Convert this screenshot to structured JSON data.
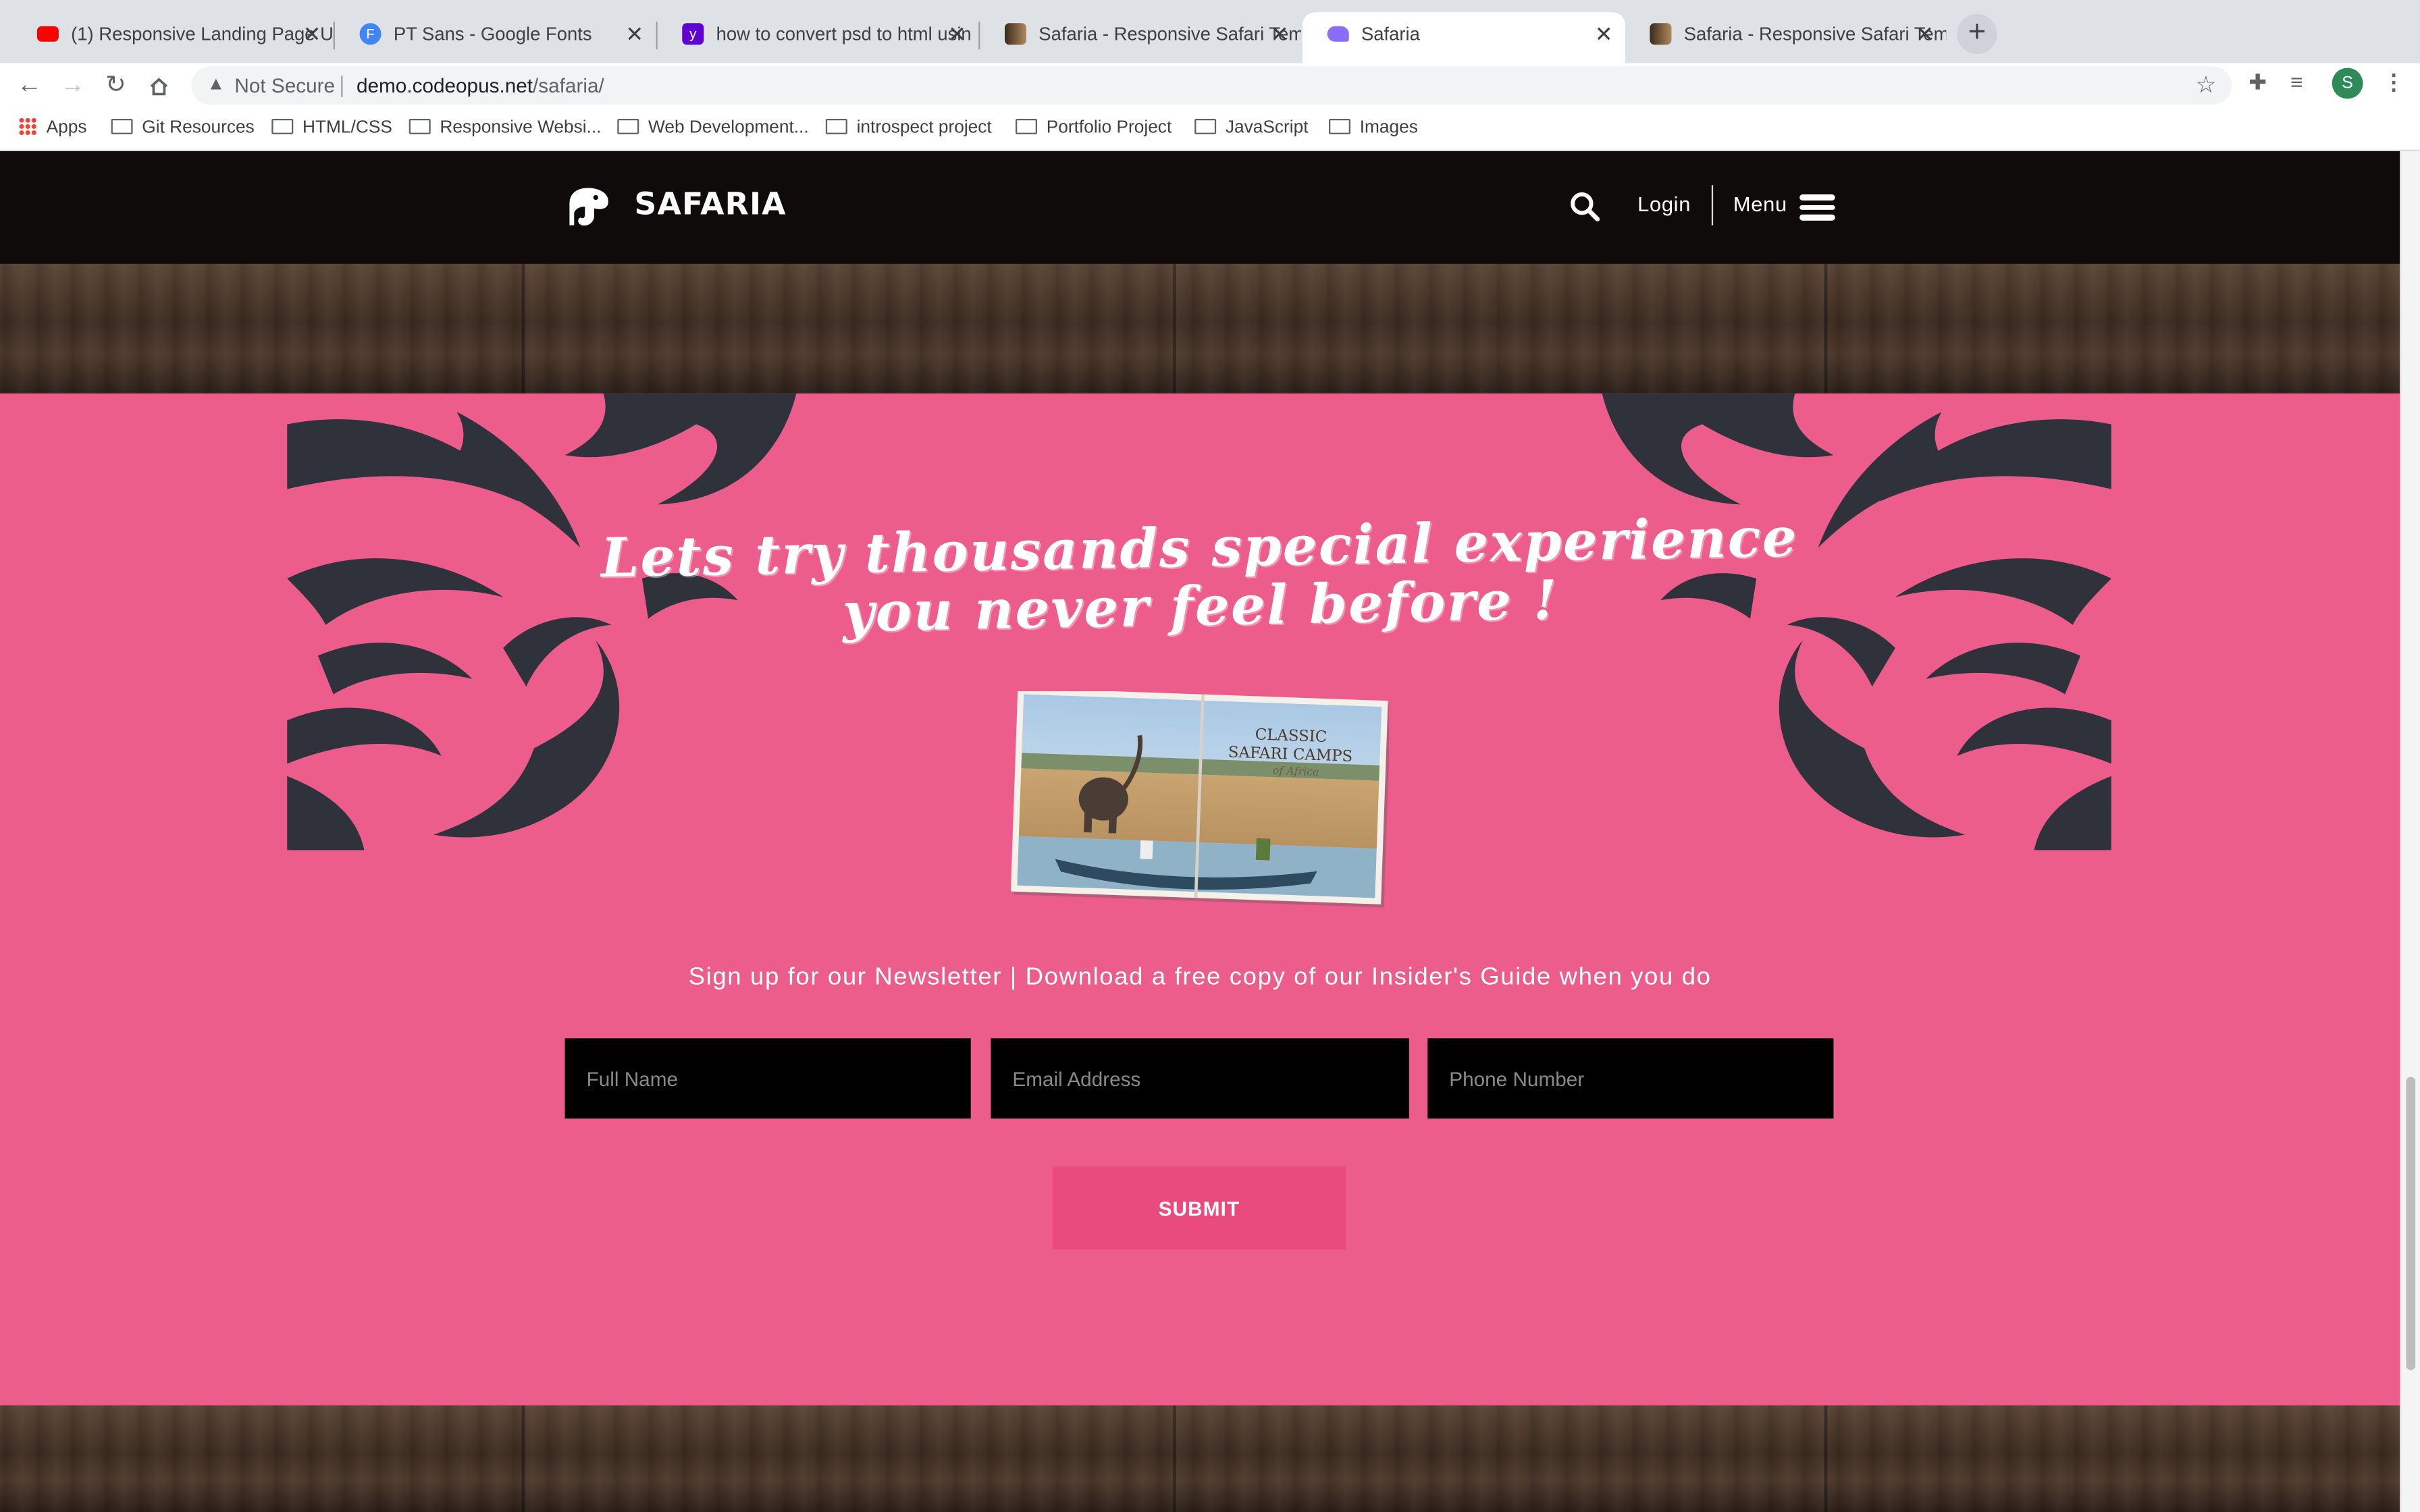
{
  "browser": {
    "tabs": [
      {
        "title": "(1) Responsive Landing Page U",
        "favicon": "youtube-icon",
        "favicon_color": "#ff0000"
      },
      {
        "title": "PT Sans - Google Fonts",
        "favicon": "google-fonts-icon",
        "favicon_color": "#4285f4"
      },
      {
        "title": "how to convert psd to html usin",
        "favicon": "yahoo-icon",
        "favicon_color": "#6001d2"
      },
      {
        "title": "Safaria - Responsive Safari Tem",
        "favicon": "safari-thumbnail-icon",
        "favicon_color": "#7a5a3a"
      },
      {
        "title": "Safaria",
        "favicon": "safaria-icon",
        "favicon_color": "#8a6cff",
        "active": true
      },
      {
        "title": "Safaria - Responsive Safari Tem",
        "favicon": "safari-thumbnail-icon",
        "favicon_color": "#7a5a3a"
      }
    ],
    "omnibox": {
      "security_label": "Not Secure",
      "url_host": "demo.codeopus.net",
      "url_path": "/safaria/"
    },
    "profile_initial": "S",
    "bookmarks": [
      {
        "label": "Apps",
        "icon": "apps-grid-icon"
      },
      {
        "label": "Git Resources",
        "icon": "folder-icon"
      },
      {
        "label": "HTML/CSS",
        "icon": "folder-icon"
      },
      {
        "label": "Responsive Websi...",
        "icon": "folder-icon"
      },
      {
        "label": "Web Development...",
        "icon": "folder-icon"
      },
      {
        "label": "introspect project",
        "icon": "folder-icon"
      },
      {
        "label": "Portfolio Project",
        "icon": "folder-icon"
      },
      {
        "label": "JavaScript",
        "icon": "folder-icon"
      },
      {
        "label": "Images",
        "icon": "folder-icon"
      }
    ]
  },
  "site": {
    "brand": "SAFARIA",
    "nav": {
      "login": "Login",
      "menu": "Menu"
    },
    "cta": {
      "headline_line1": "Lets try thousands special experience",
      "headline_line2": "you never feel before !",
      "book": {
        "title_line1": "CLASSIC",
        "title_line2": "SAFARI CAMPS",
        "title_line3": "of Africa"
      },
      "newsletter_text": "Sign up for our Newsletter | Download a free copy of our Insider's Guide when you do",
      "fields": {
        "full_name_placeholder": "Full Name",
        "email_placeholder": "Email Address",
        "phone_placeholder": "Phone Number"
      },
      "submit_label": "SUBMIT"
    },
    "colors": {
      "header_bg": "#0f0b0b",
      "section_bg": "#ec5d8c",
      "ornament": "#2f323a",
      "submit_bg": "#ea4b7f",
      "input_bg": "#000000"
    }
  }
}
